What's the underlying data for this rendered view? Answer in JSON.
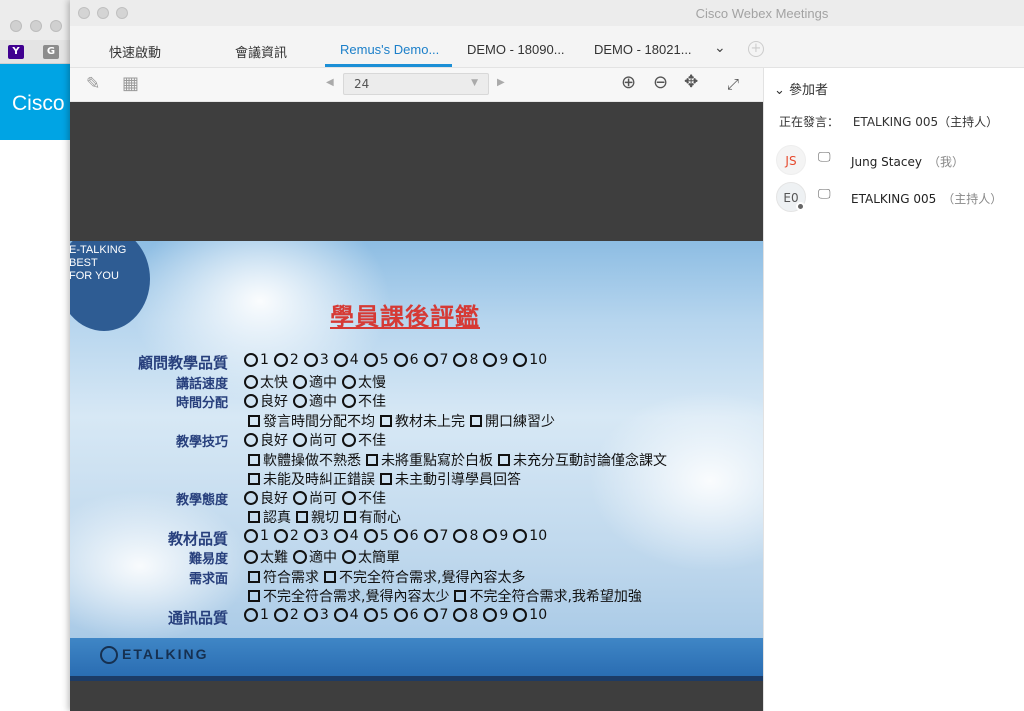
{
  "background_window": {
    "favicons": [
      "Y",
      "G"
    ],
    "banner_text": "Cisco"
  },
  "app": {
    "title": "Cisco Webex Meetings"
  },
  "tabs": [
    {
      "label": "快速啟動",
      "active": false
    },
    {
      "label": "會議資訊",
      "active": false
    },
    {
      "label": "Remus's Demo...",
      "active": true
    },
    {
      "label": "DEMO - 18090...",
      "active": false
    },
    {
      "label": "DEMO - 18021...",
      "active": false
    }
  ],
  "tab_overflow": "⌄",
  "toolbar": {
    "page_number": "24"
  },
  "participants_panel": {
    "header": "參加者",
    "speaking_label": "正在發言：",
    "speaking_name": "ETALKING 005（主持人）",
    "participants": [
      {
        "initials": "JS",
        "name": "Jung Stacey",
        "tag": "（我）"
      },
      {
        "initials": "E0",
        "name": "ETALKING 005",
        "tag": "（主持人）"
      }
    ]
  },
  "slide": {
    "circle_lines": [
      "E-TALKING",
      "BEST",
      "FOR YOU"
    ],
    "title": "學員課後評鑑",
    "rows": [
      {
        "label": "顧問教學品質",
        "style": "big",
        "type": "radio",
        "options": [
          "1",
          "2",
          "3",
          "4",
          "5",
          "6",
          "7",
          "8",
          "9",
          "10"
        ]
      },
      {
        "label": "講話速度",
        "style": "sm",
        "type": "radio",
        "options": [
          "太快",
          "適中",
          "太慢"
        ]
      },
      {
        "label": "時間分配",
        "style": "sm",
        "type": "radio",
        "options": [
          "良好",
          "適中",
          "不佳"
        ]
      },
      {
        "label": "",
        "style": "sm",
        "type": "check",
        "options": [
          "發言時間分配不均",
          "教材未上完",
          "開口練習少"
        ]
      },
      {
        "label": "教學技巧",
        "style": "sm",
        "type": "radio",
        "options": [
          "良好",
          "尚可",
          "不佳"
        ]
      },
      {
        "label": "",
        "style": "sm",
        "type": "check",
        "options": [
          "軟體操做不熟悉",
          "未將重點寫於白板",
          "未充分互動討論僅念課文"
        ]
      },
      {
        "label": "",
        "style": "sm",
        "type": "check",
        "options": [
          "未能及時糾正錯誤",
          "未主動引導學員回答"
        ]
      },
      {
        "label": "教學態度",
        "style": "sm",
        "type": "radio",
        "options": [
          "良好",
          "尚可",
          "不佳"
        ]
      },
      {
        "label": "",
        "style": "sm",
        "type": "check",
        "options": [
          "認真",
          "親切",
          "有耐心"
        ]
      },
      {
        "label": "教材品質",
        "style": "big",
        "type": "radio",
        "options": [
          "1",
          "2",
          "3",
          "4",
          "5",
          "6",
          "7",
          "8",
          "9",
          "10"
        ]
      },
      {
        "label": "難易度",
        "style": "sm",
        "type": "radio",
        "options": [
          "太難",
          "適中",
          "太簡單"
        ]
      },
      {
        "label": "需求面",
        "style": "sm",
        "type": "check",
        "options": [
          "符合需求",
          "不完全符合需求,覺得內容太多"
        ]
      },
      {
        "label": "",
        "style": "sm",
        "type": "check",
        "options": [
          "不完全符合需求,覺得內容太少",
          "不完全符合需求,我希望加強"
        ]
      },
      {
        "label": "通訊品質",
        "style": "big",
        "type": "radio",
        "options": [
          "1",
          "2",
          "3",
          "4",
          "5",
          "6",
          "7",
          "8",
          "9",
          "10"
        ]
      }
    ],
    "footer_logo": "ETALKING"
  },
  "colors": {
    "active_tab": "#1b7fc9",
    "slide_title": "#d63a35",
    "label_navy": "#273f7c"
  }
}
